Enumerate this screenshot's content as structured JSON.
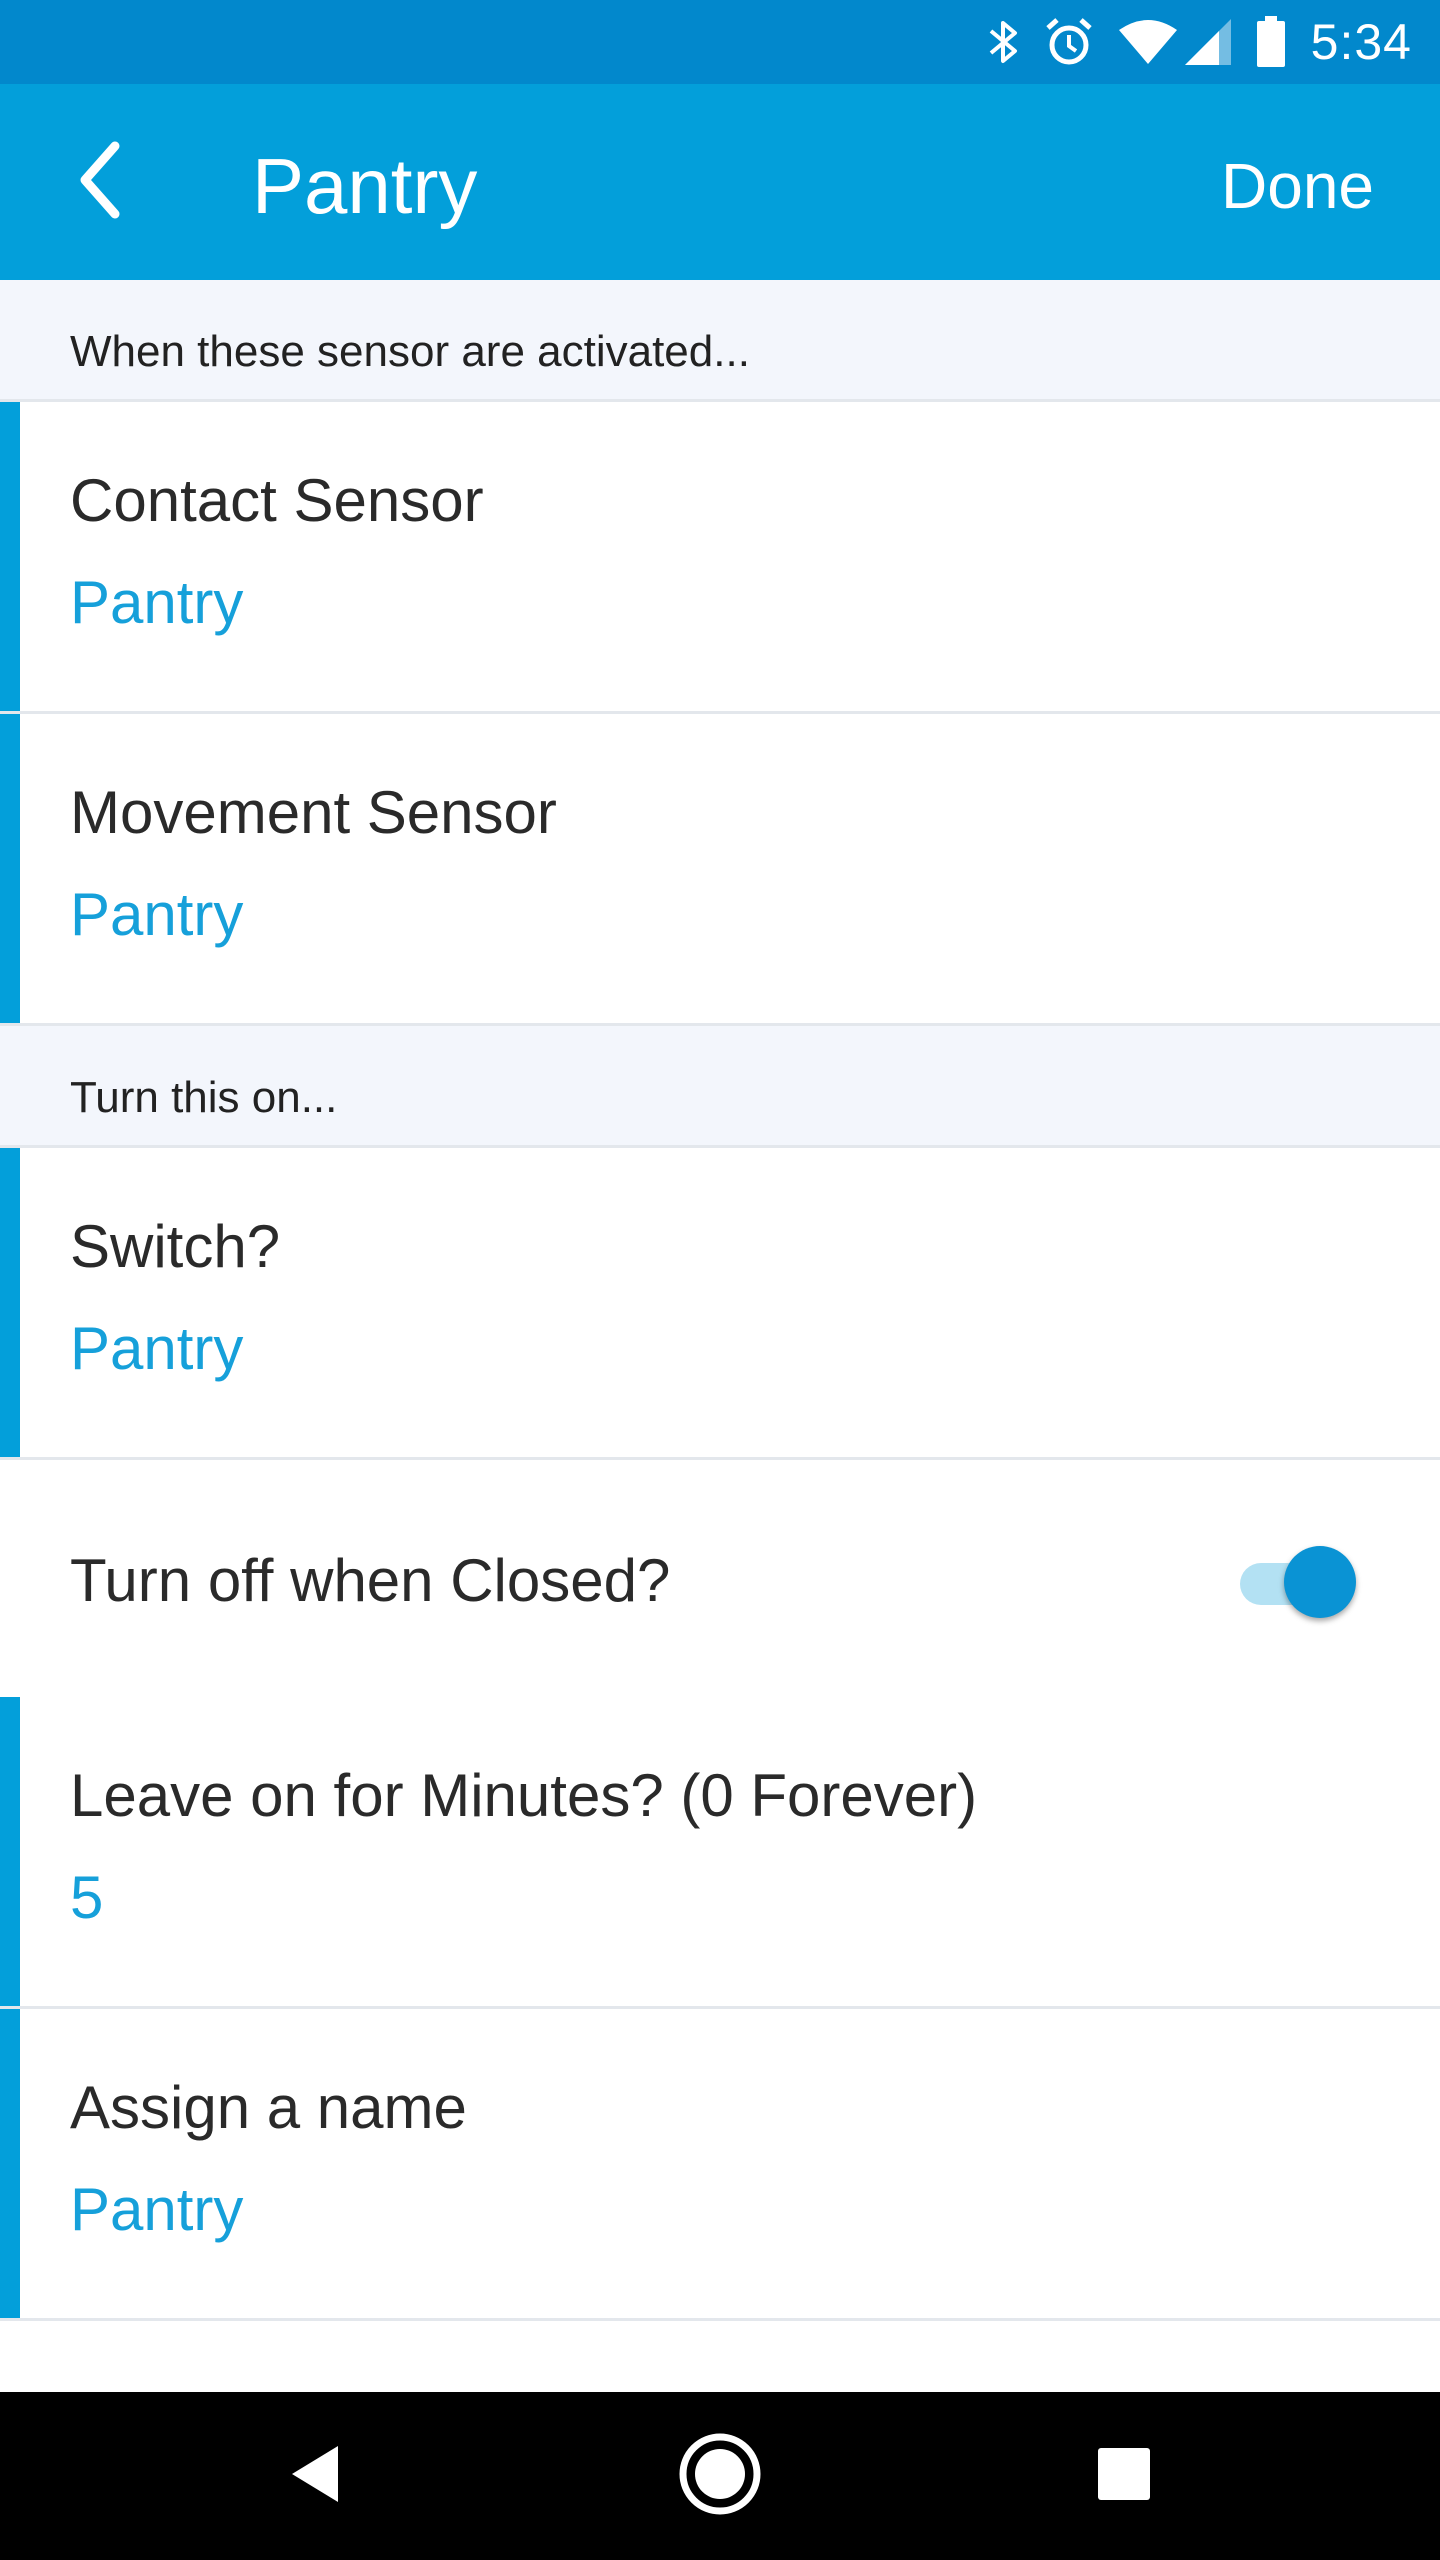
{
  "status_bar": {
    "time": "5:34",
    "icons": [
      "bluetooth-icon",
      "alarm-icon",
      "wifi-icon",
      "cell-signal-icon",
      "battery-icon"
    ]
  },
  "app_bar": {
    "title": "Pantry",
    "done_label": "Done",
    "back_icon": "chevron-left-icon"
  },
  "sections": {
    "sensors_header": "When these sensor are activated...",
    "actions_header": "Turn this on..."
  },
  "rows": {
    "contact_sensor": {
      "title": "Contact Sensor",
      "value": "Pantry"
    },
    "movement_sensor": {
      "title": "Movement Sensor",
      "value": "Pantry"
    },
    "switch": {
      "title": "Switch?",
      "value": "Pantry"
    },
    "turn_off_when_closed": {
      "title": "Turn off when Closed?",
      "enabled": true
    },
    "leave_on_minutes": {
      "title": "Leave on for Minutes? (0 Forever)",
      "value": "5"
    },
    "assign_name": {
      "title": "Assign a name",
      "value": "Pantry"
    }
  },
  "nav_bar": {
    "icons": [
      "back-triangle-icon",
      "home-circle-icon",
      "recents-square-icon"
    ]
  },
  "colors": {
    "status_bar": "#0288cc",
    "app_bar": "#039fda",
    "accent": "#039fda",
    "value_text": "#16a0da",
    "section_bg": "#f3f6fc",
    "toggle_thumb": "#0a93d4",
    "toggle_track": "#b3e1f3"
  }
}
